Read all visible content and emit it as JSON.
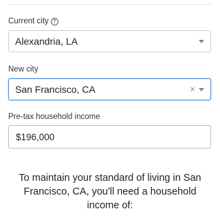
{
  "current_city": {
    "label": "Current city",
    "help_icon": "question-circle-icon",
    "value": "Alexandria, LA"
  },
  "new_city": {
    "label": "New city",
    "value": "San Francisco, CA",
    "clear_symbol": "×"
  },
  "income": {
    "label": "Pre-tax household income",
    "value": "$196,000"
  },
  "result": {
    "text": "To maintain your standard of living in San Francisco, CA, you'll need a household income of:"
  },
  "colors": {
    "focus_border": "#4a90d9",
    "border": "#cccccc",
    "text": "#222222"
  }
}
